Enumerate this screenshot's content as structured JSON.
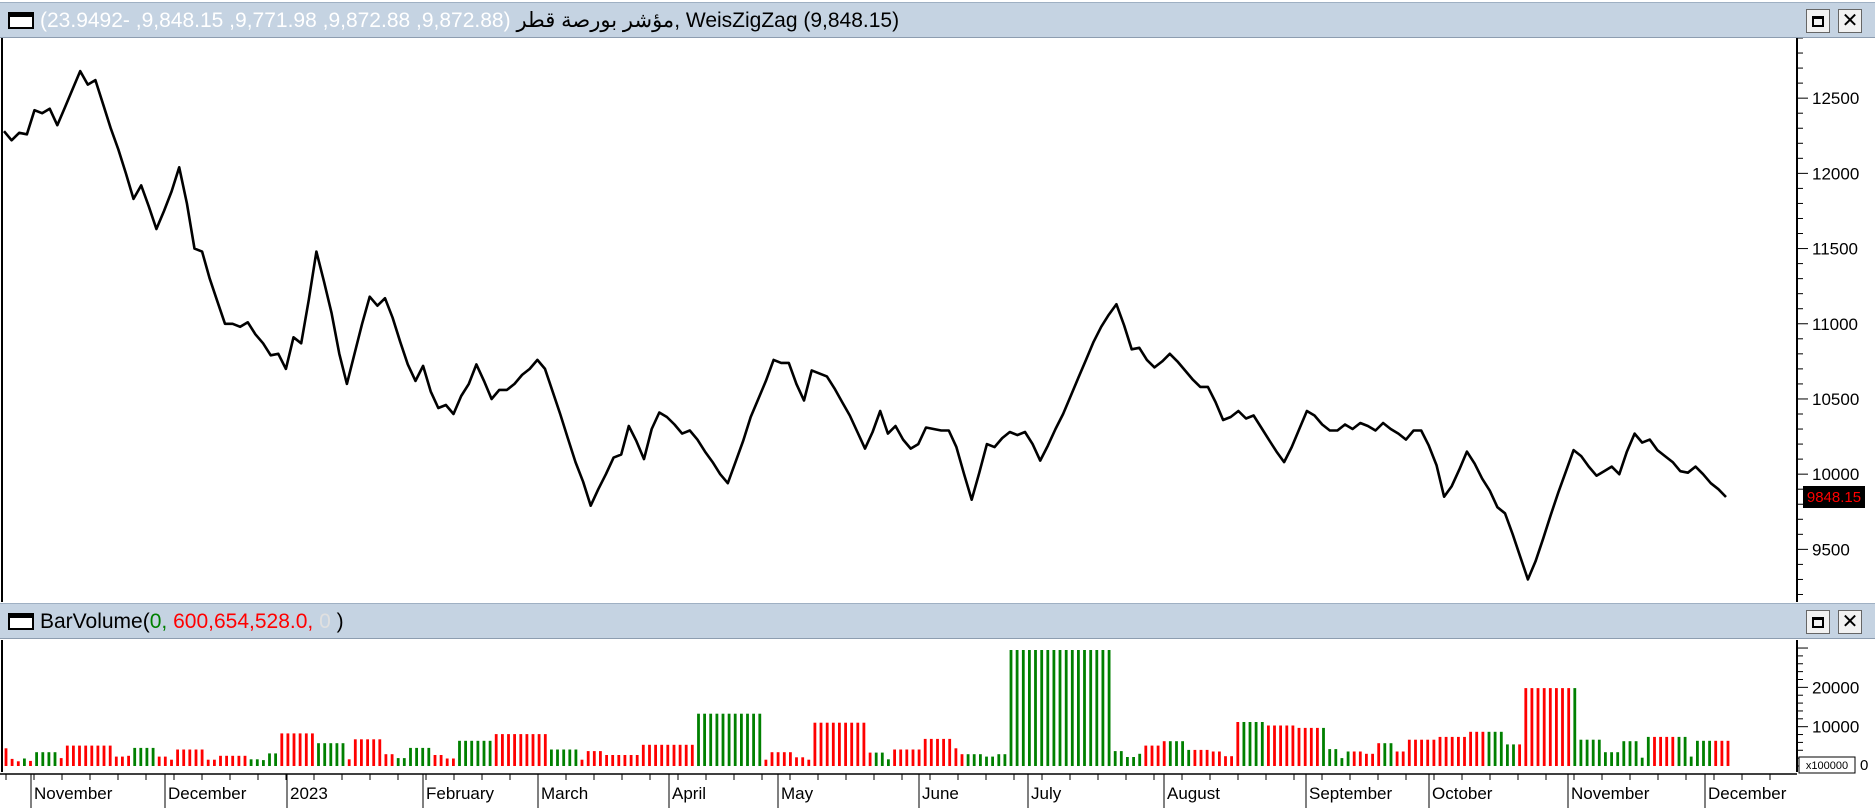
{
  "price_pane": {
    "symbol": "مؤشر بورصة قطر",
    "ohlc_values": "(9,872.88, 9,872.88, 9,771.98, 9,848.15, -23.9492)",
    "separator": ",",
    "indicator_label": "WeisZigZag (9,848.15)",
    "last_price_label": "9848.15"
  },
  "volume_pane": {
    "indicator_name": "BarVolume",
    "open_paren": "(",
    "value_1": "0,",
    "value_2": "600,654,528.0,",
    "value_3": "0",
    "close_paren": ")",
    "scale_label": "x100000",
    "zero_label": "0"
  },
  "buttons": {
    "maximize_glyph": "",
    "close_glyph": "✕"
  },
  "colors": {
    "up": "#008000",
    "down": "#ff0000",
    "line": "#000000",
    "titlebar": "#c5d3e2",
    "last_price_bg": "#000000",
    "last_price_fg": "#ff0000"
  },
  "chart_data": [
    {
      "type": "line",
      "series": [
        {
          "values": [
            12280,
            12220,
            12270,
            12260,
            12420,
            12400,
            12430,
            12320,
            12440,
            12560,
            12680,
            12590,
            12620,
            12460,
            12300,
            12160,
            12000,
            11830,
            11920,
            11780,
            11630,
            11750,
            11880,
            12040,
            11800,
            11500,
            11480,
            11300,
            11150,
            11000,
            11000,
            10980,
            11010,
            10930,
            10870,
            10790,
            10800,
            10700,
            10910,
            10870,
            11160,
            11480,
            11280,
            11070,
            10800,
            10600,
            10800,
            11000,
            11180,
            11120,
            11170,
            11040,
            10880,
            10730,
            10620,
            10720,
            10550,
            10440,
            10460,
            10400,
            10520,
            10600,
            10730,
            10620,
            10500,
            10560,
            10560,
            10600,
            10660,
            10700,
            10760,
            10700,
            10550,
            10400,
            10240,
            10080,
            9950,
            9790,
            9900,
            10000,
            10110,
            10130,
            10320,
            10220,
            10100,
            10300,
            10410,
            10380,
            10330,
            10270,
            10290,
            10230,
            10150,
            10080,
            10000,
            9940,
            10080,
            10220,
            10380,
            10500,
            10620,
            10760,
            10740,
            10740,
            10600,
            10490,
            10690,
            10670,
            10650,
            10570,
            10480,
            10390,
            10280,
            10170,
            10280,
            10420,
            10270,
            10320,
            10230,
            10170,
            10200,
            10310,
            10300,
            10290,
            10290,
            10180,
            10000,
            9830,
            10010,
            10200,
            10180,
            10240,
            10280,
            10260,
            10280,
            10200,
            10090,
            10190,
            10300,
            10400,
            10520,
            10640,
            10760,
            10880,
            10980,
            11060,
            11130,
            10990,
            10830,
            10840,
            10760,
            10710,
            10750,
            10800,
            10750,
            10690,
            10630,
            10580,
            10580,
            10480,
            10360,
            10380,
            10420,
            10370,
            10390,
            10310,
            10230,
            10150,
            10080,
            10180,
            10300,
            10420,
            10390,
            10330,
            10290,
            10290,
            10330,
            10300,
            10340,
            10320,
            10290,
            10340,
            10300,
            10270,
            10230,
            10290,
            10290,
            10190,
            10060,
            9850,
            9920,
            10030,
            10150,
            10070,
            9970,
            9890,
            9780,
            9740,
            9600,
            9450,
            9300,
            9420,
            9570,
            9730,
            9880,
            10020,
            10160,
            10120,
            10050,
            9990,
            10020,
            10050,
            10000,
            10150,
            10270,
            10210,
            10230,
            10160,
            10120,
            10080,
            10020,
            10010,
            10050,
            10000,
            9940,
            9900,
            9848.15
          ]
        }
      ],
      "yticks": [
        9500,
        10000,
        10500,
        11000,
        11500,
        12000,
        12500
      ],
      "ylim": [
        9150,
        12900
      ],
      "last_value": 9848.15
    },
    {
      "type": "bar",
      "xlabels": [
        "November",
        "December",
        "2023",
        "February",
        "March",
        "April",
        "May",
        "June",
        "July",
        "August",
        "September",
        "October",
        "November",
        "December"
      ],
      "yticks": [
        10000,
        20000
      ],
      "ylim": [
        0,
        29500
      ],
      "series": [
        {
          "values": [
            4500,
            1800,
            1200,
            1900,
            1300,
            3500,
            3500,
            3500,
            3500,
            2000,
            5200,
            5200,
            5200,
            5200,
            5200,
            5200,
            5200,
            5200,
            2400,
            2400,
            2600,
            4600,
            4600,
            4600,
            4600,
            2400,
            2400,
            1600,
            4200,
            4200,
            4200,
            4200,
            4200,
            1600,
            1600,
            2600,
            2600,
            2600,
            2600,
            2600,
            1700,
            1700,
            1500,
            3200,
            3200,
            8300,
            8300,
            8300,
            8300,
            8300,
            8300,
            5800,
            5800,
            5800,
            5800,
            5800,
            1700,
            6800,
            6800,
            6800,
            6800,
            6800,
            3000,
            3000,
            2000,
            2000,
            4600,
            4600,
            4600,
            4600,
            2800,
            2800,
            1900,
            1900,
            6400,
            6400,
            6400,
            6400,
            6400,
            6400,
            8100,
            8100,
            8100,
            8100,
            8100,
            8100,
            8100,
            8100,
            8100,
            4200,
            4200,
            4200,
            4200,
            4200,
            1600,
            3800,
            3800,
            3800,
            2800,
            2800,
            2800,
            2800,
            2800,
            2800,
            5400,
            5400,
            5400,
            5400,
            5400,
            5400,
            5400,
            5400,
            5400,
            13300,
            13300,
            13300,
            13300,
            13300,
            13300,
            13300,
            13300,
            13300,
            13300,
            13300,
            1600,
            3500,
            3500,
            3500,
            3500,
            2200,
            2200,
            1600,
            11000,
            11000,
            11000,
            11000,
            11000,
            11000,
            11000,
            11000,
            11000,
            3400,
            3400,
            3400,
            1700,
            4200,
            4200,
            4200,
            4200,
            4200,
            6900,
            6900,
            6900,
            6900,
            6900,
            4500,
            3000,
            3000,
            3000,
            3000,
            2400,
            2400,
            3000,
            3000,
            29500,
            29500,
            29500,
            29500,
            29500,
            29500,
            29500,
            29500,
            29500,
            29500,
            29500,
            29500,
            29500,
            29500,
            29500,
            29500,
            29500,
            3800,
            3800,
            2300,
            2300,
            3100,
            5200,
            5200,
            5200,
            6300,
            6300,
            6300,
            6300,
            4100,
            4100,
            4100,
            4100,
            3700,
            3700,
            2500,
            2500,
            11200,
            11200,
            11200,
            11200,
            11200,
            10300,
            10300,
            10300,
            10300,
            10300,
            9700,
            9700,
            9700,
            9700,
            9700,
            4300,
            4300,
            2000,
            3700,
            3700,
            3700,
            3100,
            3100,
            5800,
            5800,
            5800,
            3700,
            3700,
            6700,
            6700,
            6700,
            6700,
            6700,
            7400,
            7400,
            7400,
            7400,
            7400,
            8700,
            8700,
            8700,
            8700,
            8700,
            8700,
            5500,
            5500,
            5500,
            19800,
            19800,
            19800,
            19800,
            19800,
            19800,
            19800,
            19800,
            19800,
            6700,
            6700,
            6700,
            6700,
            3500,
            3500,
            3500,
            6300,
            6300,
            6300,
            2100,
            7400,
            7400,
            7400,
            7400,
            7400,
            7400,
            7400,
            2400,
            6400,
            6400,
            6400,
            6400,
            6400,
            6400
          ],
          "colors": [
            "down",
            "down",
            "down",
            "up",
            "down",
            "up",
            "up",
            "up",
            "up",
            "down",
            "down",
            "down",
            "down",
            "down",
            "down",
            "down",
            "down",
            "down",
            "down",
            "down",
            "down",
            "up",
            "up",
            "up",
            "up",
            "down",
            "down",
            "down",
            "down",
            "down",
            "down",
            "down",
            "down",
            "down",
            "down",
            "down",
            "down",
            "down",
            "down",
            "down",
            "up",
            "up",
            "up",
            "up",
            "up",
            "down",
            "down",
            "down",
            "down",
            "down",
            "down",
            "up",
            "up",
            "up",
            "up",
            "up",
            "down",
            "down",
            "down",
            "down",
            "down",
            "down",
            "down",
            "down",
            "up",
            "up",
            "up",
            "up",
            "up",
            "up",
            "down",
            "down",
            "down",
            "down",
            "up",
            "up",
            "up",
            "up",
            "up",
            "up",
            "down",
            "down",
            "down",
            "down",
            "down",
            "down",
            "down",
            "down",
            "down",
            "up",
            "up",
            "up",
            "up",
            "up",
            "down",
            "down",
            "down",
            "down",
            "down",
            "down",
            "down",
            "down",
            "down",
            "down",
            "down",
            "down",
            "down",
            "down",
            "down",
            "down",
            "down",
            "down",
            "down",
            "up",
            "up",
            "up",
            "up",
            "up",
            "up",
            "up",
            "up",
            "up",
            "up",
            "up",
            "down",
            "down",
            "down",
            "down",
            "down",
            "down",
            "down",
            "down",
            "down",
            "down",
            "down",
            "down",
            "down",
            "down",
            "down",
            "down",
            "down",
            "down",
            "up",
            "up",
            "up",
            "down",
            "down",
            "down",
            "down",
            "down",
            "down",
            "down",
            "down",
            "down",
            "down",
            "down",
            "down",
            "up",
            "up",
            "up",
            "up",
            "up",
            "up",
            "up",
            "up",
            "up",
            "up",
            "up",
            "up",
            "up",
            "up",
            "up",
            "up",
            "up",
            "up",
            "up",
            "up",
            "up",
            "up",
            "up",
            "up",
            "up",
            "up",
            "up",
            "up",
            "up",
            "down",
            "down",
            "down",
            "down",
            "up",
            "up",
            "up",
            "up",
            "down",
            "down",
            "down",
            "down",
            "down",
            "down",
            "down",
            "down",
            "up",
            "up",
            "up",
            "up",
            "down",
            "down",
            "down",
            "down",
            "down",
            "down",
            "down",
            "down",
            "down",
            "up",
            "up",
            "up",
            "up",
            "up",
            "down",
            "down",
            "down",
            "down",
            "down",
            "up",
            "up",
            "down",
            "down",
            "down",
            "down",
            "down",
            "down",
            "down",
            "down",
            "down",
            "down",
            "down",
            "down",
            "down",
            "down",
            "down",
            "up",
            "up",
            "up",
            "up",
            "up",
            "down",
            "down",
            "down",
            "down",
            "down",
            "down",
            "down",
            "down",
            "down",
            "up",
            "up",
            "up",
            "up",
            "up",
            "up",
            "up",
            "up",
            "up",
            "up",
            "up",
            "up",
            "up",
            "down",
            "down",
            "down",
            "down",
            "up",
            "up",
            "up",
            "up",
            "up",
            "up",
            "down",
            "down",
            "down",
            "down",
            "down",
            "down",
            "down",
            "down",
            "down",
            "down",
            "down",
            "down",
            "down",
            "down",
            "down",
            "down"
          ]
        }
      ]
    }
  ]
}
